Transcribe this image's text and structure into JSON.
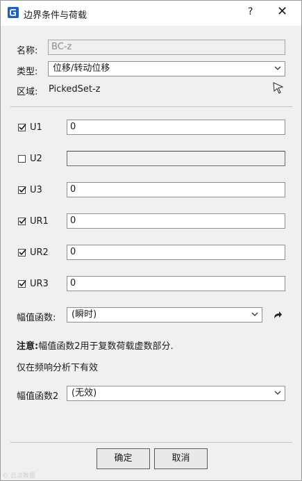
{
  "window": {
    "title": "边界条件与荷载",
    "help_label": "?",
    "close_label": "✕"
  },
  "name": {
    "label": "名称:",
    "value": "BC-z"
  },
  "type": {
    "label": "类型:",
    "value": "位移/转动位移"
  },
  "region": {
    "label": "区域:",
    "value": "PickedSet-z"
  },
  "dofs": [
    {
      "label": "U1",
      "checked": true,
      "value": "0",
      "enabled": true
    },
    {
      "label": "U2",
      "checked": false,
      "value": "",
      "enabled": false
    },
    {
      "label": "U3",
      "checked": true,
      "value": "0",
      "enabled": true
    },
    {
      "label": "UR1",
      "checked": true,
      "value": "0",
      "enabled": true
    },
    {
      "label": "UR2",
      "checked": true,
      "value": "0",
      "enabled": true
    },
    {
      "label": "UR3",
      "checked": true,
      "value": "0",
      "enabled": true
    }
  ],
  "amplitude": {
    "label": "幅值函数:",
    "value": "(瞬时)"
  },
  "note": {
    "bold": "注意:",
    "text": "幅值函数2用于复数荷载虚数部分.",
    "line2": "仅在频响分析下有效"
  },
  "amplitude2": {
    "label": "幅值函数2",
    "value": "(无效)"
  },
  "buttons": {
    "ok": "确定",
    "cancel": "取消"
  },
  "watermark": "© 云淡数据"
}
